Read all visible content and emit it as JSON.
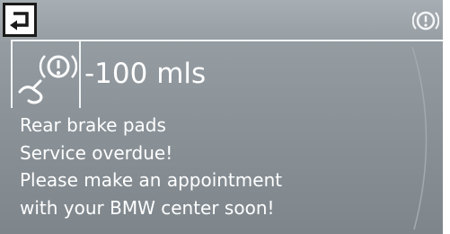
{
  "status": {
    "distance": "-100 mls"
  },
  "message": {
    "lines": [
      "Rear brake pads",
      "Service overdue!",
      "Please make an appointment",
      "with your BMW center soon!"
    ]
  },
  "icons": {
    "back": "back-arrow-icon",
    "warning": "warning-circle-icon",
    "brake_service": "brake-service-icon"
  },
  "colors": {
    "background": "#8b9399",
    "text": "#ffffff",
    "frame": "#f2f4f5",
    "back_button_border": "#1a1a1a"
  }
}
